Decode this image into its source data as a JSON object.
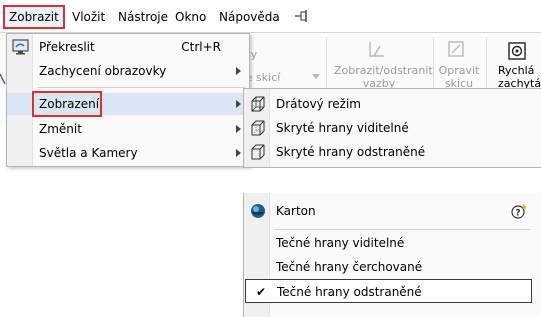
{
  "menubar": {
    "items": [
      "Zobrazit",
      "Vložit",
      "Nástroje",
      "Okno",
      "Nápověda"
    ],
    "active_index": 0,
    "pin_icon": "pin-icon"
  },
  "ribbon": {
    "faded_1": "ntity",
    "faded_2": "ole skicí",
    "show_hide_line1": "Zobrazit/odstranit",
    "show_hide_line2": "vazby",
    "repair_line1": "Opravit",
    "repair_line2": "skicu",
    "quick_line1": "Rychlá",
    "quick_line2": "zachytávání"
  },
  "menu": {
    "items": [
      {
        "label": "Překreslit",
        "shortcut": "Ctrl+R",
        "icon": "redraw-icon",
        "submenu": false
      },
      {
        "label": "Zachycení obrazovky",
        "shortcut": "",
        "submenu": true
      },
      {
        "label": "Zobrazení",
        "shortcut": "",
        "submenu": true,
        "highlighted": true
      },
      {
        "label": "Změnit",
        "shortcut": "",
        "submenu": true
      },
      {
        "label": "Světla a Kamery",
        "shortcut": "",
        "submenu": true
      }
    ]
  },
  "submenu": {
    "items": [
      {
        "label": "Drátový režim",
        "icon": "wireframe-icon"
      },
      {
        "label": "Skryté hrany viditelné",
        "icon": "hidden-lines-visible-icon"
      },
      {
        "label": "Skryté hrany odstraněné",
        "icon": "hidden-lines-removed-icon"
      }
    ],
    "lower_items": [
      {
        "label": "Karton",
        "icon": "cartoon-icon",
        "help": true
      },
      {
        "label": "Tečné hrany viditelné"
      },
      {
        "label": "Tečné hrany čerchované"
      },
      {
        "label": "Tečné hrany odstraněné",
        "checked": true,
        "check_mark": "✔"
      }
    ]
  },
  "colors": {
    "highlight_border": "#e0302a",
    "menu_hover": "#d8e6f6"
  }
}
